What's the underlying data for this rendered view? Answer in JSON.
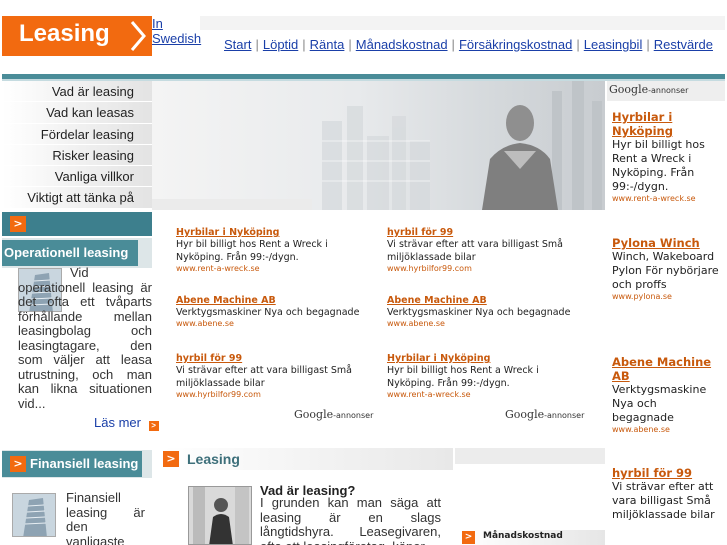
{
  "header": {
    "logo_text": "Leasing",
    "lang_label": "In Swedish"
  },
  "topnav": [
    "Start",
    "Löptid",
    "Ränta",
    "Månadskostnad",
    "Försäkringskostnad",
    "Leasingbil",
    "Restvärde"
  ],
  "leftmenu": [
    "Vad är leasing",
    "Vad kan leasas",
    "Fördelar leasing",
    "Risker leasing",
    "Vanliga villkor",
    "Viktigt att tänka på"
  ],
  "operational": {
    "title": "Operationell leasing",
    "text": "Vid operationell leasing är det ofta ett tvåparts förhållande mellan leasingbolag och leasingtagare, den som väljer att leasa utrustning, och man kan likna situationen vid...",
    "more": "Läs mer"
  },
  "financial": {
    "title": "Finansiell leasing",
    "text": "Finansiell leasing är den vanligaste typen av"
  },
  "ads_grid": [
    {
      "title": "Hyrbilar i Nyköping",
      "text": "Hyr bil billigt hos Rent a Wreck i Nyköping. Från 99:-/dygn.",
      "url": "www.rent-a-wreck.se"
    },
    {
      "title": "hyrbil för 99",
      "text": "Vi strävar efter att vara billigast Små miljöklassade bilar",
      "url": "www.hyrbilfor99.com"
    },
    {
      "title": "Abene Machine AB",
      "text": "Verktygsmaskiner Nya och begagnade",
      "url": "www.abene.se"
    },
    {
      "title": "Abene Machine AB",
      "text": "Verktygsmaskiner Nya och begagnade",
      "url": "www.abene.se"
    },
    {
      "title": "hyrbil för 99",
      "text": "Vi strävar efter att vara billigast Små miljöklassade bilar",
      "url": "www.hyrbilfor99.com"
    },
    {
      "title": "Hyrbilar i Nyköping",
      "text": "Hyr bil billigt hos Rent a Wreck i Nyköping. Från 99:-/dygn.",
      "url": "www.rent-a-wreck.se"
    }
  ],
  "google": {
    "brand": "Google",
    "suffix": "-annonser"
  },
  "ads_right": [
    {
      "title": "Hyrbilar i Nyköping",
      "text": "Hyr bil billigt hos Rent a Wreck i Nyköping. Från 99:-/dygn.",
      "url": "www.rent-a-wreck.se"
    },
    {
      "title": "Pylona Winch",
      "text": "Winch, Wakeboard Pylon För nybörjare och proffs",
      "url": "www.pylona.se"
    },
    {
      "title": "Abene Machine AB",
      "text": "Verktygsmaskine Nya och begagnade",
      "url": "www.abene.se"
    },
    {
      "title": "hyrbil för 99",
      "text": "Vi strävar efter att vara billigast Små miljöklassade bilar",
      "url": ""
    }
  ],
  "main": {
    "title": "Leasing",
    "heading": "Vad är leasing?",
    "text": "I grunden kan man säga att leasing är en slags långtidshyra. Leasegivaren, ofta ett leasingföretag, köper",
    "side_label": "Månadskostnad"
  },
  "colors": {
    "accent": "#f26a10",
    "teal": "#4a8c98",
    "link": "#1a3fa8",
    "ad_orange": "#c8590c"
  }
}
